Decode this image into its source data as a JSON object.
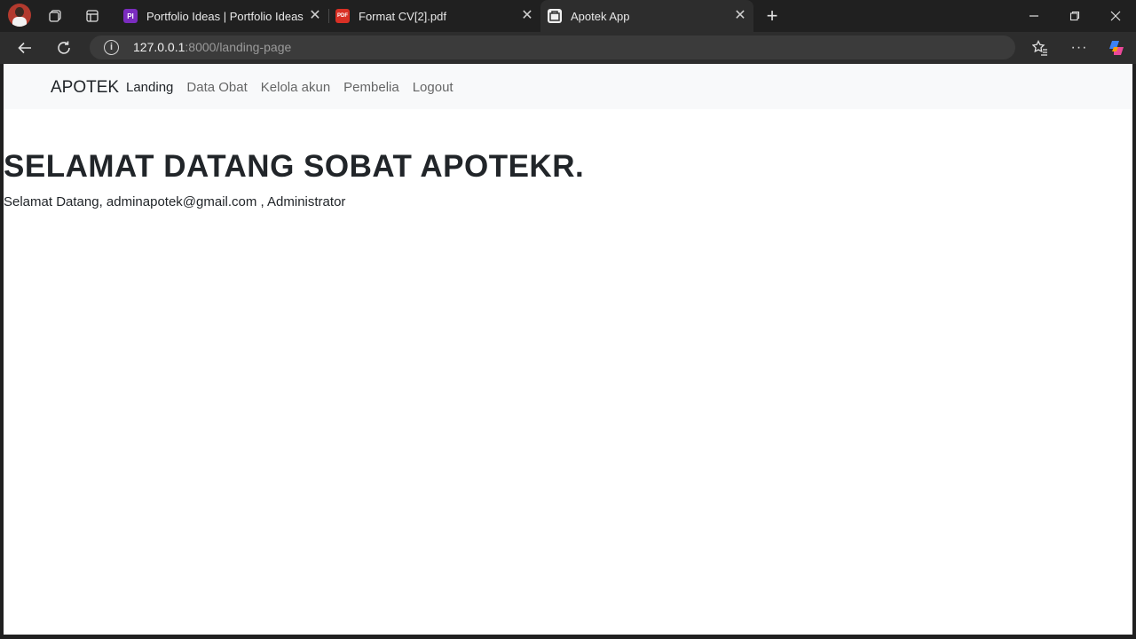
{
  "browser": {
    "tabs": [
      {
        "title": "Portfolio Ideas | Portfolio Ideas",
        "favicon": "PI",
        "active": false
      },
      {
        "title": "Format CV[2].pdf",
        "favicon": "PDF",
        "active": false
      },
      {
        "title": "Apotek App",
        "favicon": "",
        "active": true
      }
    ],
    "address": {
      "host": "127.0.0.1",
      "path": ":8000/landing-page"
    },
    "new_tab_label": "+"
  },
  "navbar": {
    "brand": "APOTEK",
    "links": [
      {
        "label": "Landing",
        "active": true
      },
      {
        "label": "Data Obat",
        "active": false
      },
      {
        "label": "Kelola akun",
        "active": false
      },
      {
        "label": "Pembelia",
        "active": false
      },
      {
        "label": "Logout",
        "active": false
      }
    ]
  },
  "main": {
    "title": "SELAMAT DATANG SOBAT APOTEKR.",
    "welcome": "Selamat Datang, adminapotek@gmail.com , Administrator"
  },
  "colors": {
    "chrome_bg": "#202020",
    "toolbar_bg": "#2d2d2d",
    "navbar_bg": "#f8f9fa",
    "text": "#212529"
  }
}
